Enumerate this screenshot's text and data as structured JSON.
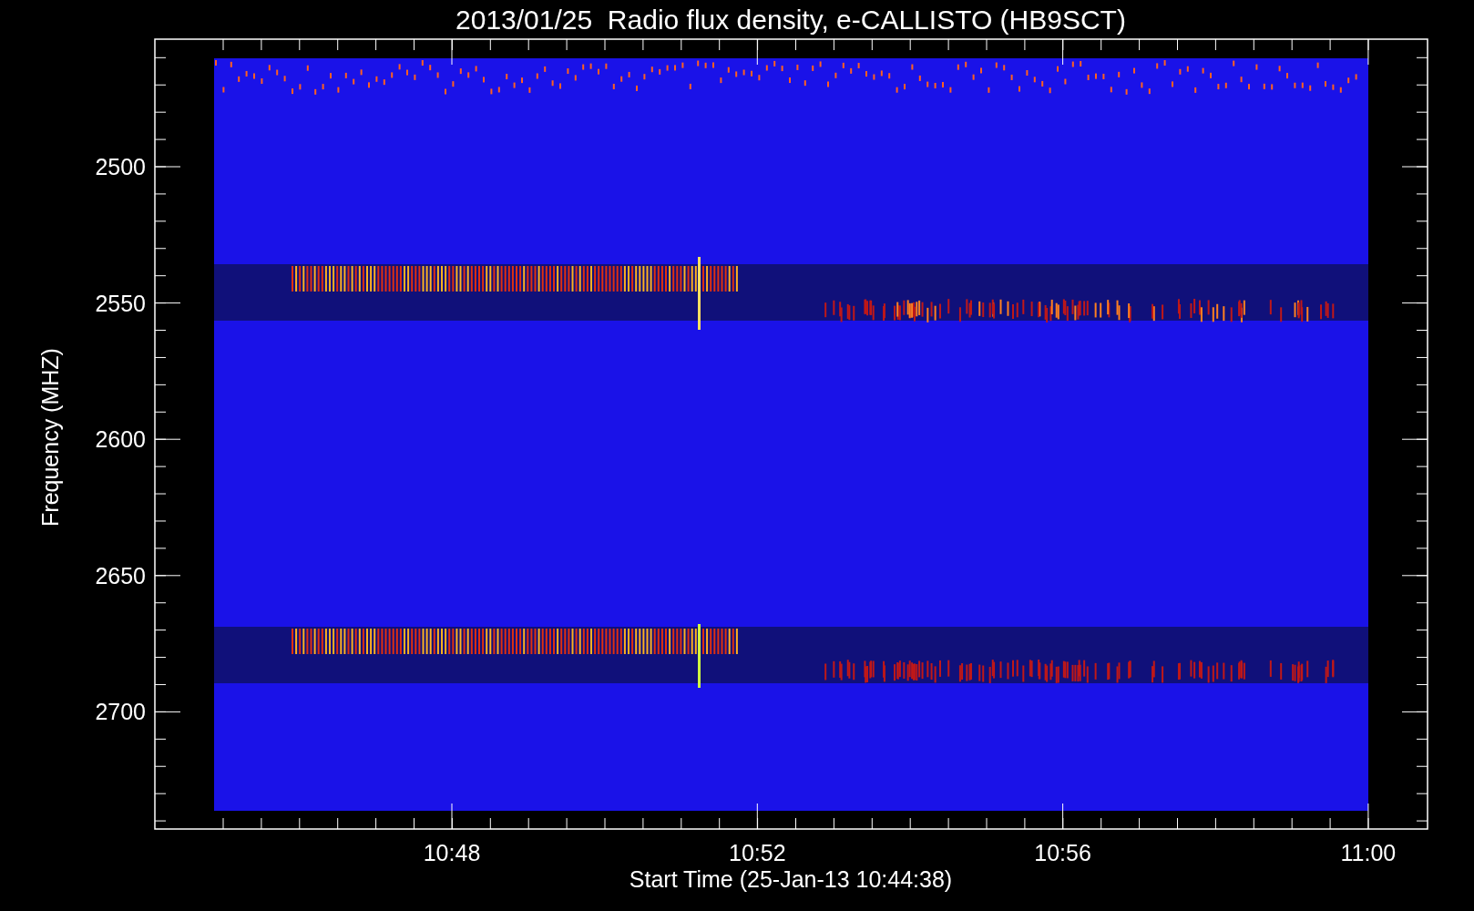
{
  "title": "2013/01/25  Radio flux density, e-CALLISTO (HB9SCT)",
  "y_axis": {
    "label": "Frequency (MHZ)",
    "ticks": [
      "2500",
      "2550",
      "2600",
      "2650",
      "2700"
    ]
  },
  "x_axis": {
    "label": "Start Time (25-Jan-13 10:44:38)",
    "ticks": [
      "10:48",
      "10:52",
      "10:56",
      "11:00"
    ]
  }
}
